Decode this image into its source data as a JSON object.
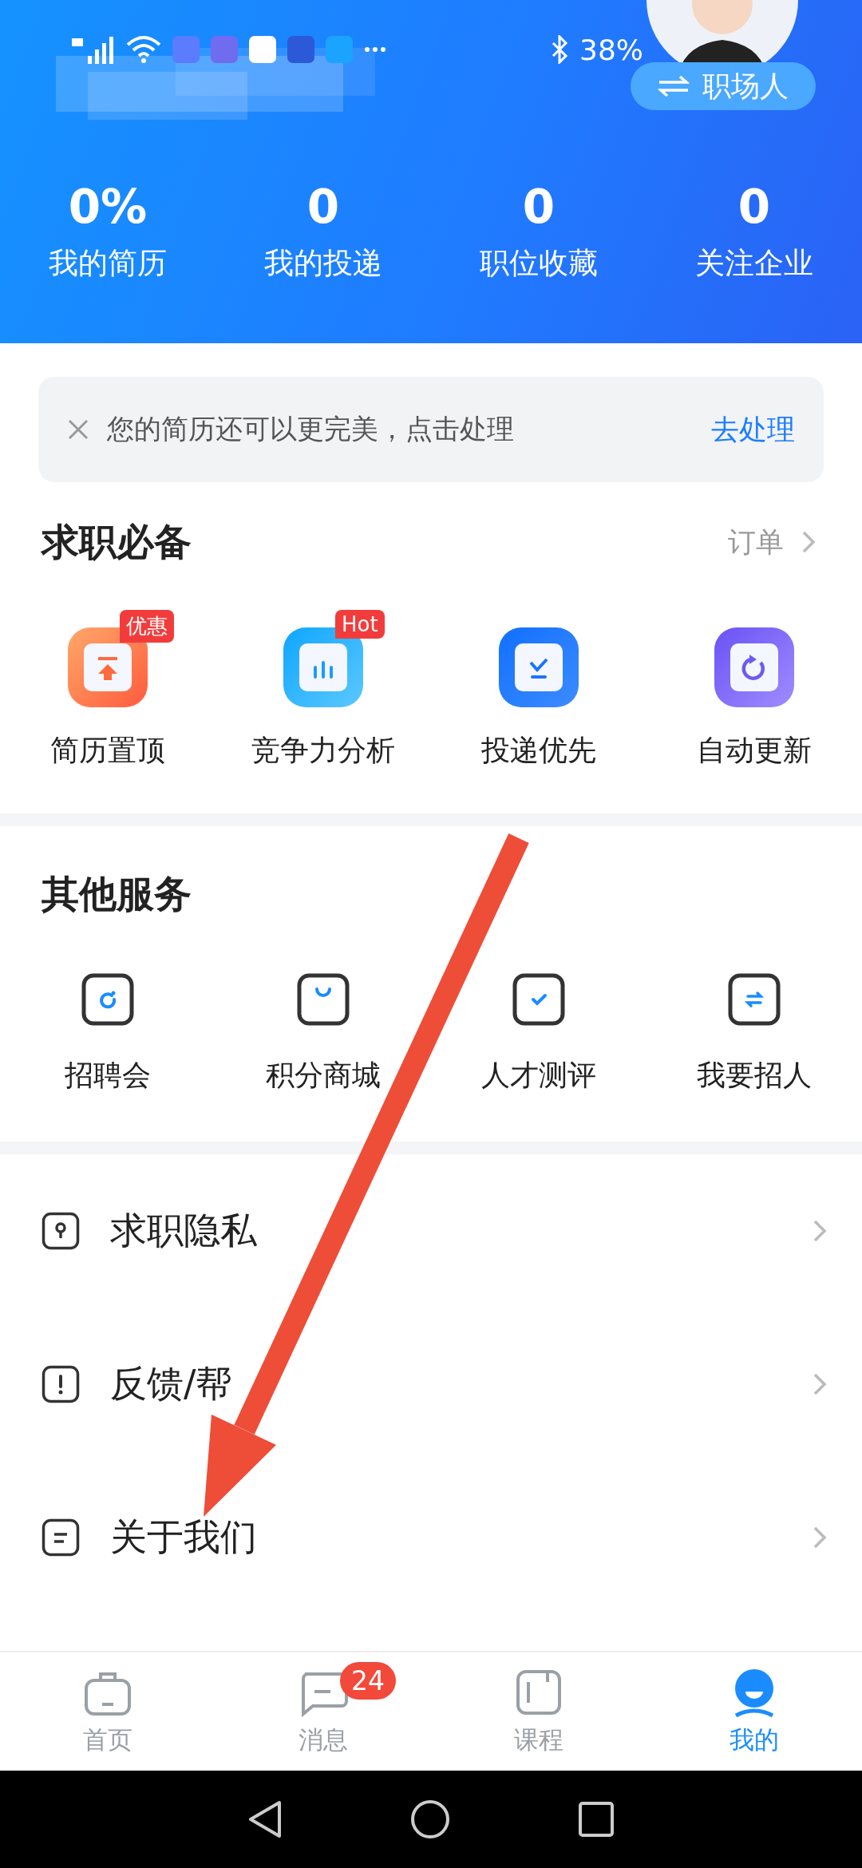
{
  "status_bar": {
    "battery": "38%"
  },
  "header": {
    "role_button": "职场人",
    "stats": [
      {
        "value": "0%",
        "label": "我的简历"
      },
      {
        "value": "0",
        "label": "我的投递"
      },
      {
        "value": "0",
        "label": "职位收藏"
      },
      {
        "value": "0",
        "label": "关注企业"
      }
    ]
  },
  "notice": {
    "text": "您的简历还可以更完美，点击处理",
    "action": "去处理"
  },
  "essentials": {
    "title": "求职必备",
    "link": "订单",
    "items": [
      {
        "label": "简历置顶",
        "kind": "top",
        "badge": "优惠"
      },
      {
        "label": "竞争力分析",
        "kind": "chart",
        "badge": "Hot"
      },
      {
        "label": "投递优先",
        "kind": "deliver"
      },
      {
        "label": "自动更新",
        "kind": "refresh"
      }
    ]
  },
  "services": {
    "title": "其他服务",
    "items": [
      {
        "label": "招聘会",
        "kind": "fair"
      },
      {
        "label": "积分商城",
        "kind": "mall"
      },
      {
        "label": "人才测评",
        "kind": "test"
      },
      {
        "label": "我要招人",
        "kind": "hire"
      }
    ]
  },
  "menu": [
    {
      "label": "求职隐私",
      "kind": "privacy"
    },
    {
      "label": "反馈/帮",
      "kind": "help"
    },
    {
      "label": "关于我们",
      "kind": "about"
    }
  ],
  "tabs": [
    {
      "label": "首页",
      "kind": "home",
      "selected": false
    },
    {
      "label": "消息",
      "kind": "messages",
      "selected": false,
      "badge": "24"
    },
    {
      "label": "课程",
      "kind": "courses",
      "selected": false
    },
    {
      "label": "我的",
      "kind": "me",
      "selected": true
    }
  ]
}
